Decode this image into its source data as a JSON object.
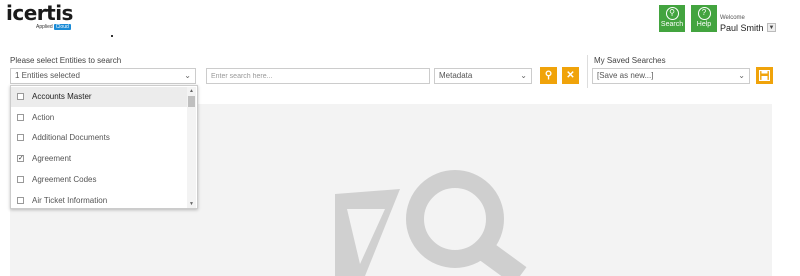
{
  "logo": {
    "word": "icertis",
    "sub": "Applied",
    "badge": "Cloud"
  },
  "header": {
    "search_button": {
      "label": "Search",
      "icon": "search-icon"
    },
    "help_button": {
      "label": "Help",
      "icon": "help-icon"
    },
    "welcome_text": "Welcome",
    "user_name": "Paul Smith",
    "user_menu_icon": "caret-down-icon"
  },
  "filters": {
    "entities_label": "Please select Entities to search",
    "entities_selected": "1 Entities selected",
    "search_placeholder": "Enter search here...",
    "metadata_value": "Metadata",
    "saved_label": "My Saved Searches",
    "saved_value": "[Save as new...]",
    "colors": {
      "accent": "#f0a30a",
      "green": "#43a43f"
    }
  },
  "entities": [
    {
      "label": "Accounts Master",
      "checked": false,
      "highlighted": true
    },
    {
      "label": "Action",
      "checked": false,
      "highlighted": false
    },
    {
      "label": "Additional Documents",
      "checked": false,
      "highlighted": false
    },
    {
      "label": "Agreement",
      "checked": true,
      "highlighted": false
    },
    {
      "label": "Agreement Codes",
      "checked": false,
      "highlighted": false
    },
    {
      "label": "Air Ticket Information",
      "checked": false,
      "highlighted": false
    }
  ]
}
